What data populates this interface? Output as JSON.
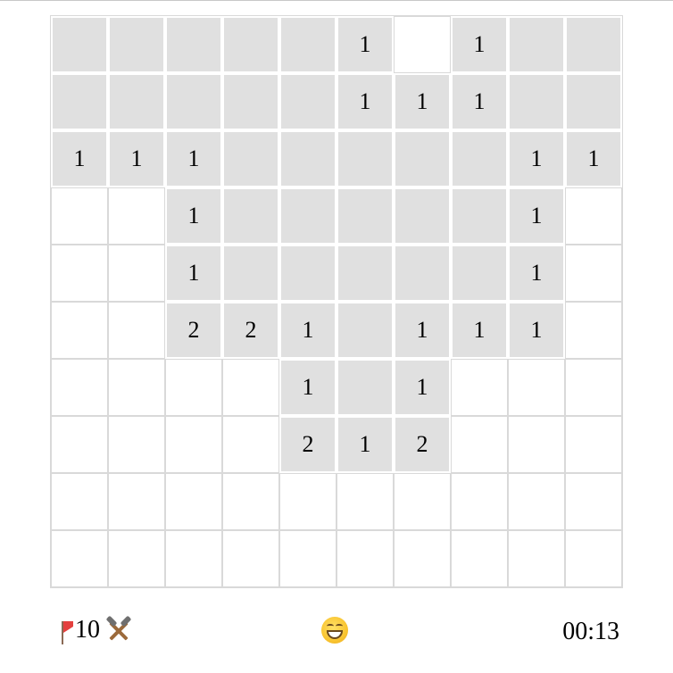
{
  "board": {
    "rows": [
      [
        {
          "s": "c",
          "v": ""
        },
        {
          "s": "c",
          "v": ""
        },
        {
          "s": "c",
          "v": ""
        },
        {
          "s": "c",
          "v": ""
        },
        {
          "s": "c",
          "v": ""
        },
        {
          "s": "c",
          "v": "1"
        },
        {
          "s": "o",
          "v": ""
        },
        {
          "s": "c",
          "v": "1"
        },
        {
          "s": "c",
          "v": ""
        },
        {
          "s": "c",
          "v": ""
        }
      ],
      [
        {
          "s": "c",
          "v": ""
        },
        {
          "s": "c",
          "v": ""
        },
        {
          "s": "c",
          "v": ""
        },
        {
          "s": "c",
          "v": ""
        },
        {
          "s": "c",
          "v": ""
        },
        {
          "s": "c",
          "v": "1"
        },
        {
          "s": "c",
          "v": "1"
        },
        {
          "s": "c",
          "v": "1"
        },
        {
          "s": "c",
          "v": ""
        },
        {
          "s": "c",
          "v": ""
        }
      ],
      [
        {
          "s": "c",
          "v": "1"
        },
        {
          "s": "c",
          "v": "1"
        },
        {
          "s": "c",
          "v": "1"
        },
        {
          "s": "c",
          "v": ""
        },
        {
          "s": "c",
          "v": ""
        },
        {
          "s": "c",
          "v": ""
        },
        {
          "s": "c",
          "v": ""
        },
        {
          "s": "c",
          "v": ""
        },
        {
          "s": "c",
          "v": "1"
        },
        {
          "s": "c",
          "v": "1"
        }
      ],
      [
        {
          "s": "o",
          "v": ""
        },
        {
          "s": "o",
          "v": ""
        },
        {
          "s": "c",
          "v": "1"
        },
        {
          "s": "c",
          "v": ""
        },
        {
          "s": "c",
          "v": ""
        },
        {
          "s": "c",
          "v": ""
        },
        {
          "s": "c",
          "v": ""
        },
        {
          "s": "c",
          "v": ""
        },
        {
          "s": "c",
          "v": "1"
        },
        {
          "s": "o",
          "v": ""
        }
      ],
      [
        {
          "s": "o",
          "v": ""
        },
        {
          "s": "o",
          "v": ""
        },
        {
          "s": "c",
          "v": "1"
        },
        {
          "s": "c",
          "v": ""
        },
        {
          "s": "c",
          "v": ""
        },
        {
          "s": "c",
          "v": ""
        },
        {
          "s": "c",
          "v": ""
        },
        {
          "s": "c",
          "v": ""
        },
        {
          "s": "c",
          "v": "1"
        },
        {
          "s": "o",
          "v": ""
        }
      ],
      [
        {
          "s": "o",
          "v": ""
        },
        {
          "s": "o",
          "v": ""
        },
        {
          "s": "c",
          "v": "2"
        },
        {
          "s": "c",
          "v": "2"
        },
        {
          "s": "c",
          "v": "1"
        },
        {
          "s": "c",
          "v": ""
        },
        {
          "s": "c",
          "v": "1"
        },
        {
          "s": "c",
          "v": "1"
        },
        {
          "s": "c",
          "v": "1"
        },
        {
          "s": "o",
          "v": ""
        }
      ],
      [
        {
          "s": "o",
          "v": ""
        },
        {
          "s": "o",
          "v": ""
        },
        {
          "s": "o",
          "v": ""
        },
        {
          "s": "o",
          "v": ""
        },
        {
          "s": "c",
          "v": "1"
        },
        {
          "s": "c",
          "v": ""
        },
        {
          "s": "c",
          "v": "1"
        },
        {
          "s": "o",
          "v": ""
        },
        {
          "s": "o",
          "v": ""
        },
        {
          "s": "o",
          "v": ""
        }
      ],
      [
        {
          "s": "o",
          "v": ""
        },
        {
          "s": "o",
          "v": ""
        },
        {
          "s": "o",
          "v": ""
        },
        {
          "s": "o",
          "v": ""
        },
        {
          "s": "c",
          "v": "2"
        },
        {
          "s": "c",
          "v": "1"
        },
        {
          "s": "c",
          "v": "2"
        },
        {
          "s": "o",
          "v": ""
        },
        {
          "s": "o",
          "v": ""
        },
        {
          "s": "o",
          "v": ""
        }
      ],
      [
        {
          "s": "o",
          "v": ""
        },
        {
          "s": "o",
          "v": ""
        },
        {
          "s": "o",
          "v": ""
        },
        {
          "s": "o",
          "v": ""
        },
        {
          "s": "o",
          "v": ""
        },
        {
          "s": "o",
          "v": ""
        },
        {
          "s": "o",
          "v": ""
        },
        {
          "s": "o",
          "v": ""
        },
        {
          "s": "o",
          "v": ""
        },
        {
          "s": "o",
          "v": ""
        }
      ],
      [
        {
          "s": "o",
          "v": ""
        },
        {
          "s": "o",
          "v": ""
        },
        {
          "s": "o",
          "v": ""
        },
        {
          "s": "o",
          "v": ""
        },
        {
          "s": "o",
          "v": ""
        },
        {
          "s": "o",
          "v": ""
        },
        {
          "s": "o",
          "v": ""
        },
        {
          "s": "o",
          "v": ""
        },
        {
          "s": "o",
          "v": ""
        },
        {
          "s": "o",
          "v": ""
        }
      ]
    ]
  },
  "status": {
    "flag_icon": "flag-icon",
    "flags_count": "10",
    "tool_icon": "hammer-pick-icon",
    "face_icon": "smiley-face-icon",
    "timer": "00:13"
  },
  "colors": {
    "revealed_cell": "#e0e0e0",
    "unrevealed_cell": "#ffffff",
    "grid_line": "#d9d9d9",
    "flag": "#e4403e"
  }
}
